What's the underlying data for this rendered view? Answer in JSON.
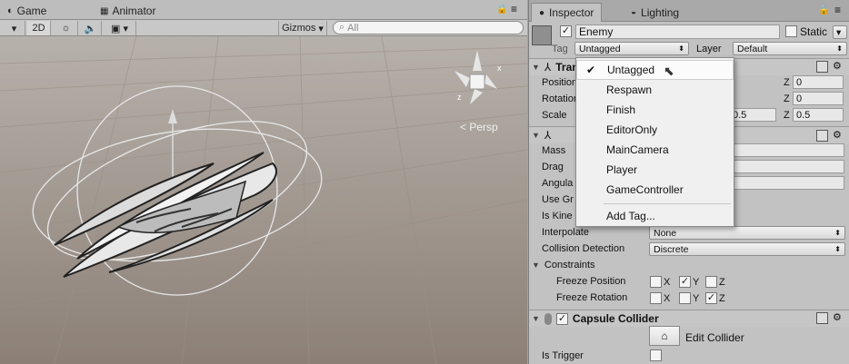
{
  "scene": {
    "tabs": [
      {
        "label": "Game"
      },
      {
        "label": "Animator"
      }
    ],
    "toolbar": {
      "mode_2d": "2D",
      "gizmos": "Gizmos",
      "search_placeholder": "All"
    },
    "persp_label": "Persp"
  },
  "inspector": {
    "tabs": [
      {
        "label": "Inspector"
      },
      {
        "label": "Lighting"
      }
    ],
    "object": {
      "name": "Enemy",
      "active": true,
      "static_label": "Static",
      "static": false
    },
    "tag_label": "Tag",
    "tag_value": "Untagged",
    "layer_label": "Layer",
    "layer_value": "Default",
    "transform": {
      "title": "Transform",
      "position_label": "Position",
      "rotation_label": "Rotation",
      "scale_label": "Scale",
      "position_z": "0",
      "rotation_z": "0",
      "scale_y": "0.5",
      "scale_z": "0.5",
      "z_label": "Z"
    },
    "rigidbody": {
      "mass_label": "Mass",
      "drag_label": "Drag",
      "angular_label": "Angula",
      "use_gravity_label": "Use Gr",
      "is_kinematic_label": "Is Kine",
      "interpolate_label": "Interpolate",
      "interpolate_value": "None",
      "collision_label": "Collision Detection",
      "collision_value": "Discrete",
      "constraints_label": "Constraints",
      "freeze_position_label": "Freeze Position",
      "freeze_rotation_label": "Freeze Rotation",
      "x": "X",
      "y": "Y",
      "z": "Z",
      "freeze_position": {
        "x": false,
        "y": true,
        "z": false
      },
      "freeze_rotation": {
        "x": false,
        "y": false,
        "z": true
      }
    },
    "capsule": {
      "title": "Capsule Collider",
      "edit_collider": "Edit Collider",
      "is_trigger_label": "Is Trigger"
    }
  },
  "tag_dropdown": {
    "items": [
      "Untagged",
      "Respawn",
      "Finish",
      "EditorOnly",
      "MainCamera",
      "Player",
      "GameController"
    ],
    "selected": "Untagged",
    "add_tag": "Add Tag..."
  }
}
